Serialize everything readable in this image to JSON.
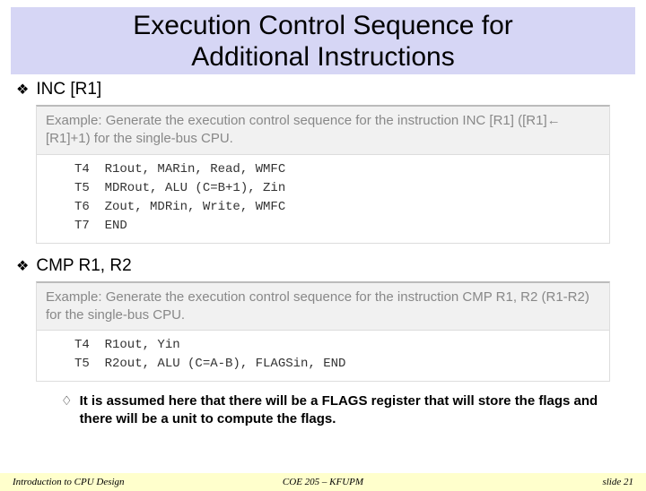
{
  "title_line1": "Execution Control Sequence for",
  "title_line2": "Additional Instructions",
  "section1": {
    "label": "INC [R1]",
    "example_header": "Example: Generate the execution control sequence for the instruction INC [R1] ([R1]← [R1]+1) for the single-bus CPU.",
    "steps": [
      "T4  R1out, MARin, Read, WMFC",
      "T5  MDRout, ALU (C=B+1), Zin",
      "T6  Zout, MDRin, Write, WMFC",
      "T7  END"
    ]
  },
  "section2": {
    "label": "CMP R1, R2",
    "example_header": "Example: Generate the execution control sequence for the instruction CMP R1, R2 (R1-R2) for the single-bus CPU.",
    "steps": [
      "T4  R1out, Yin",
      "T5  R2out, ALU (C=A-B), FLAGSin, END"
    ]
  },
  "note": "It is assumed here that there will be a FLAGS register that will store the flags and there will be a unit to compute the flags.",
  "footer": {
    "left": "Introduction to CPU Design",
    "center": "COE 205 – KFUPM",
    "right": "slide 21"
  }
}
